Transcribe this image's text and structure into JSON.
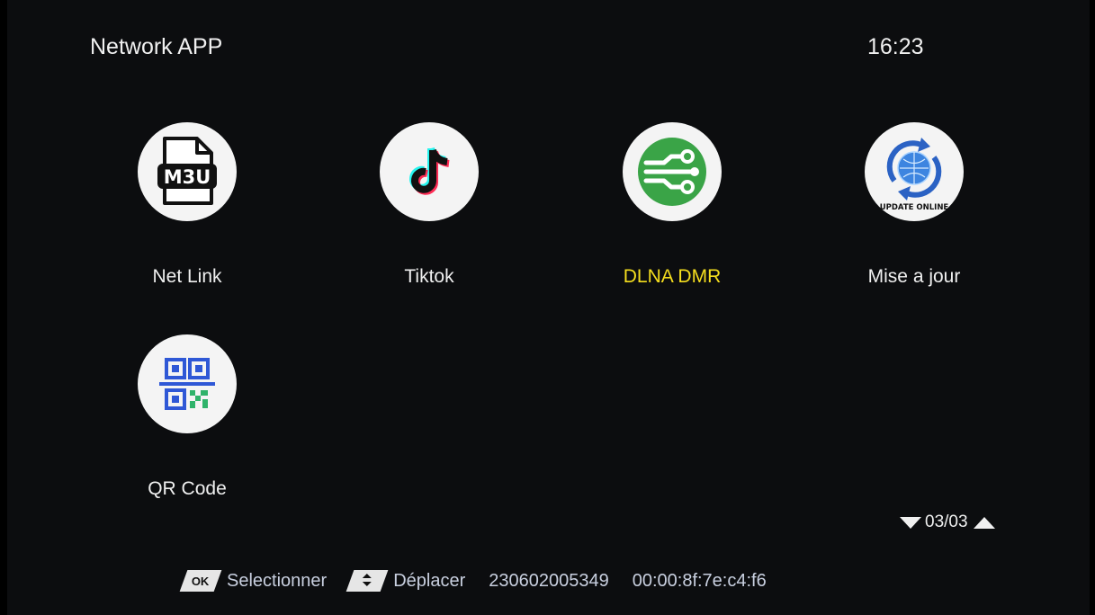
{
  "header": {
    "title": "Network APP",
    "clock": "16:23"
  },
  "apps": [
    {
      "label": "Net Link",
      "icon": "m3u-file-icon"
    },
    {
      "label": "Tiktok",
      "icon": "tiktok-icon"
    },
    {
      "label": "DLNA DMR",
      "icon": "dlna-icon",
      "selected": true
    },
    {
      "label": "Mise a jour",
      "icon": "update-online-icon",
      "icon_text": "UPDATE ONLINE"
    },
    {
      "label": "QR Code",
      "icon": "qr-code-icon"
    }
  ],
  "m3u_icon_text": "M3U",
  "pager": {
    "text": "03/03"
  },
  "footer": {
    "ok_key": "OK",
    "ok_label": "Selectionner",
    "move_label": "Déplacer",
    "serial": "230602005349",
    "mac": "00:00:8f:7e:c4:f6"
  },
  "colors": {
    "background": "#0c0d0f",
    "selected_text": "#f5de1e",
    "dlna_green": "#3aa447",
    "qr_blue": "#2f58d6",
    "qr_green": "#2fb36a"
  }
}
